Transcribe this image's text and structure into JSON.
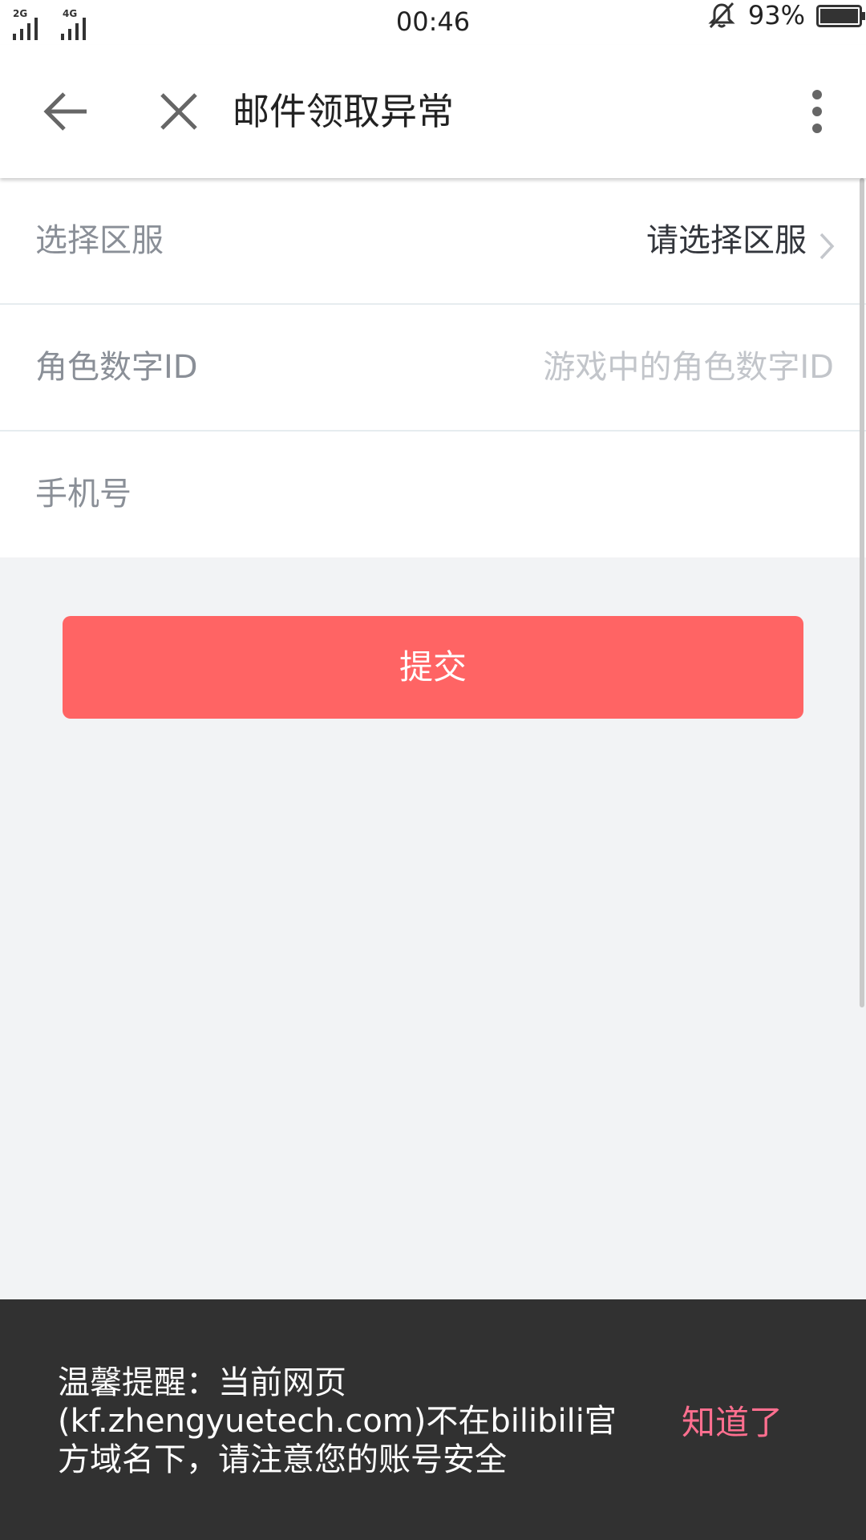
{
  "status_bar": {
    "sim1": "2G",
    "sim2": "4G",
    "time": "00:46",
    "battery": "93%",
    "icons": [
      "signal-icon",
      "mute-icon",
      "battery-icon"
    ]
  },
  "title_bar": {
    "title": "邮件领取异常",
    "icons": [
      "back-arrow-icon",
      "close-icon",
      "more-vertical-icon"
    ]
  },
  "form": {
    "server": {
      "label": "选择区服",
      "value": "请选择区服"
    },
    "role_id": {
      "label": "角色数字ID",
      "placeholder": "游戏中的角色数字ID"
    },
    "phone": {
      "label": "手机号",
      "placeholder": ""
    }
  },
  "submit_label": "提交",
  "notice": {
    "text": "温馨提醒：当前网页(kf.zhengyuetech.com)不在bilibili官方域名下，请注意您的账号安全",
    "ok_label": "知道了"
  },
  "colors": {
    "accent": "#ff6464",
    "notice_bg": "#313131",
    "notice_ok": "#ff6f8f",
    "page_bg": "#f2f3f5"
  }
}
